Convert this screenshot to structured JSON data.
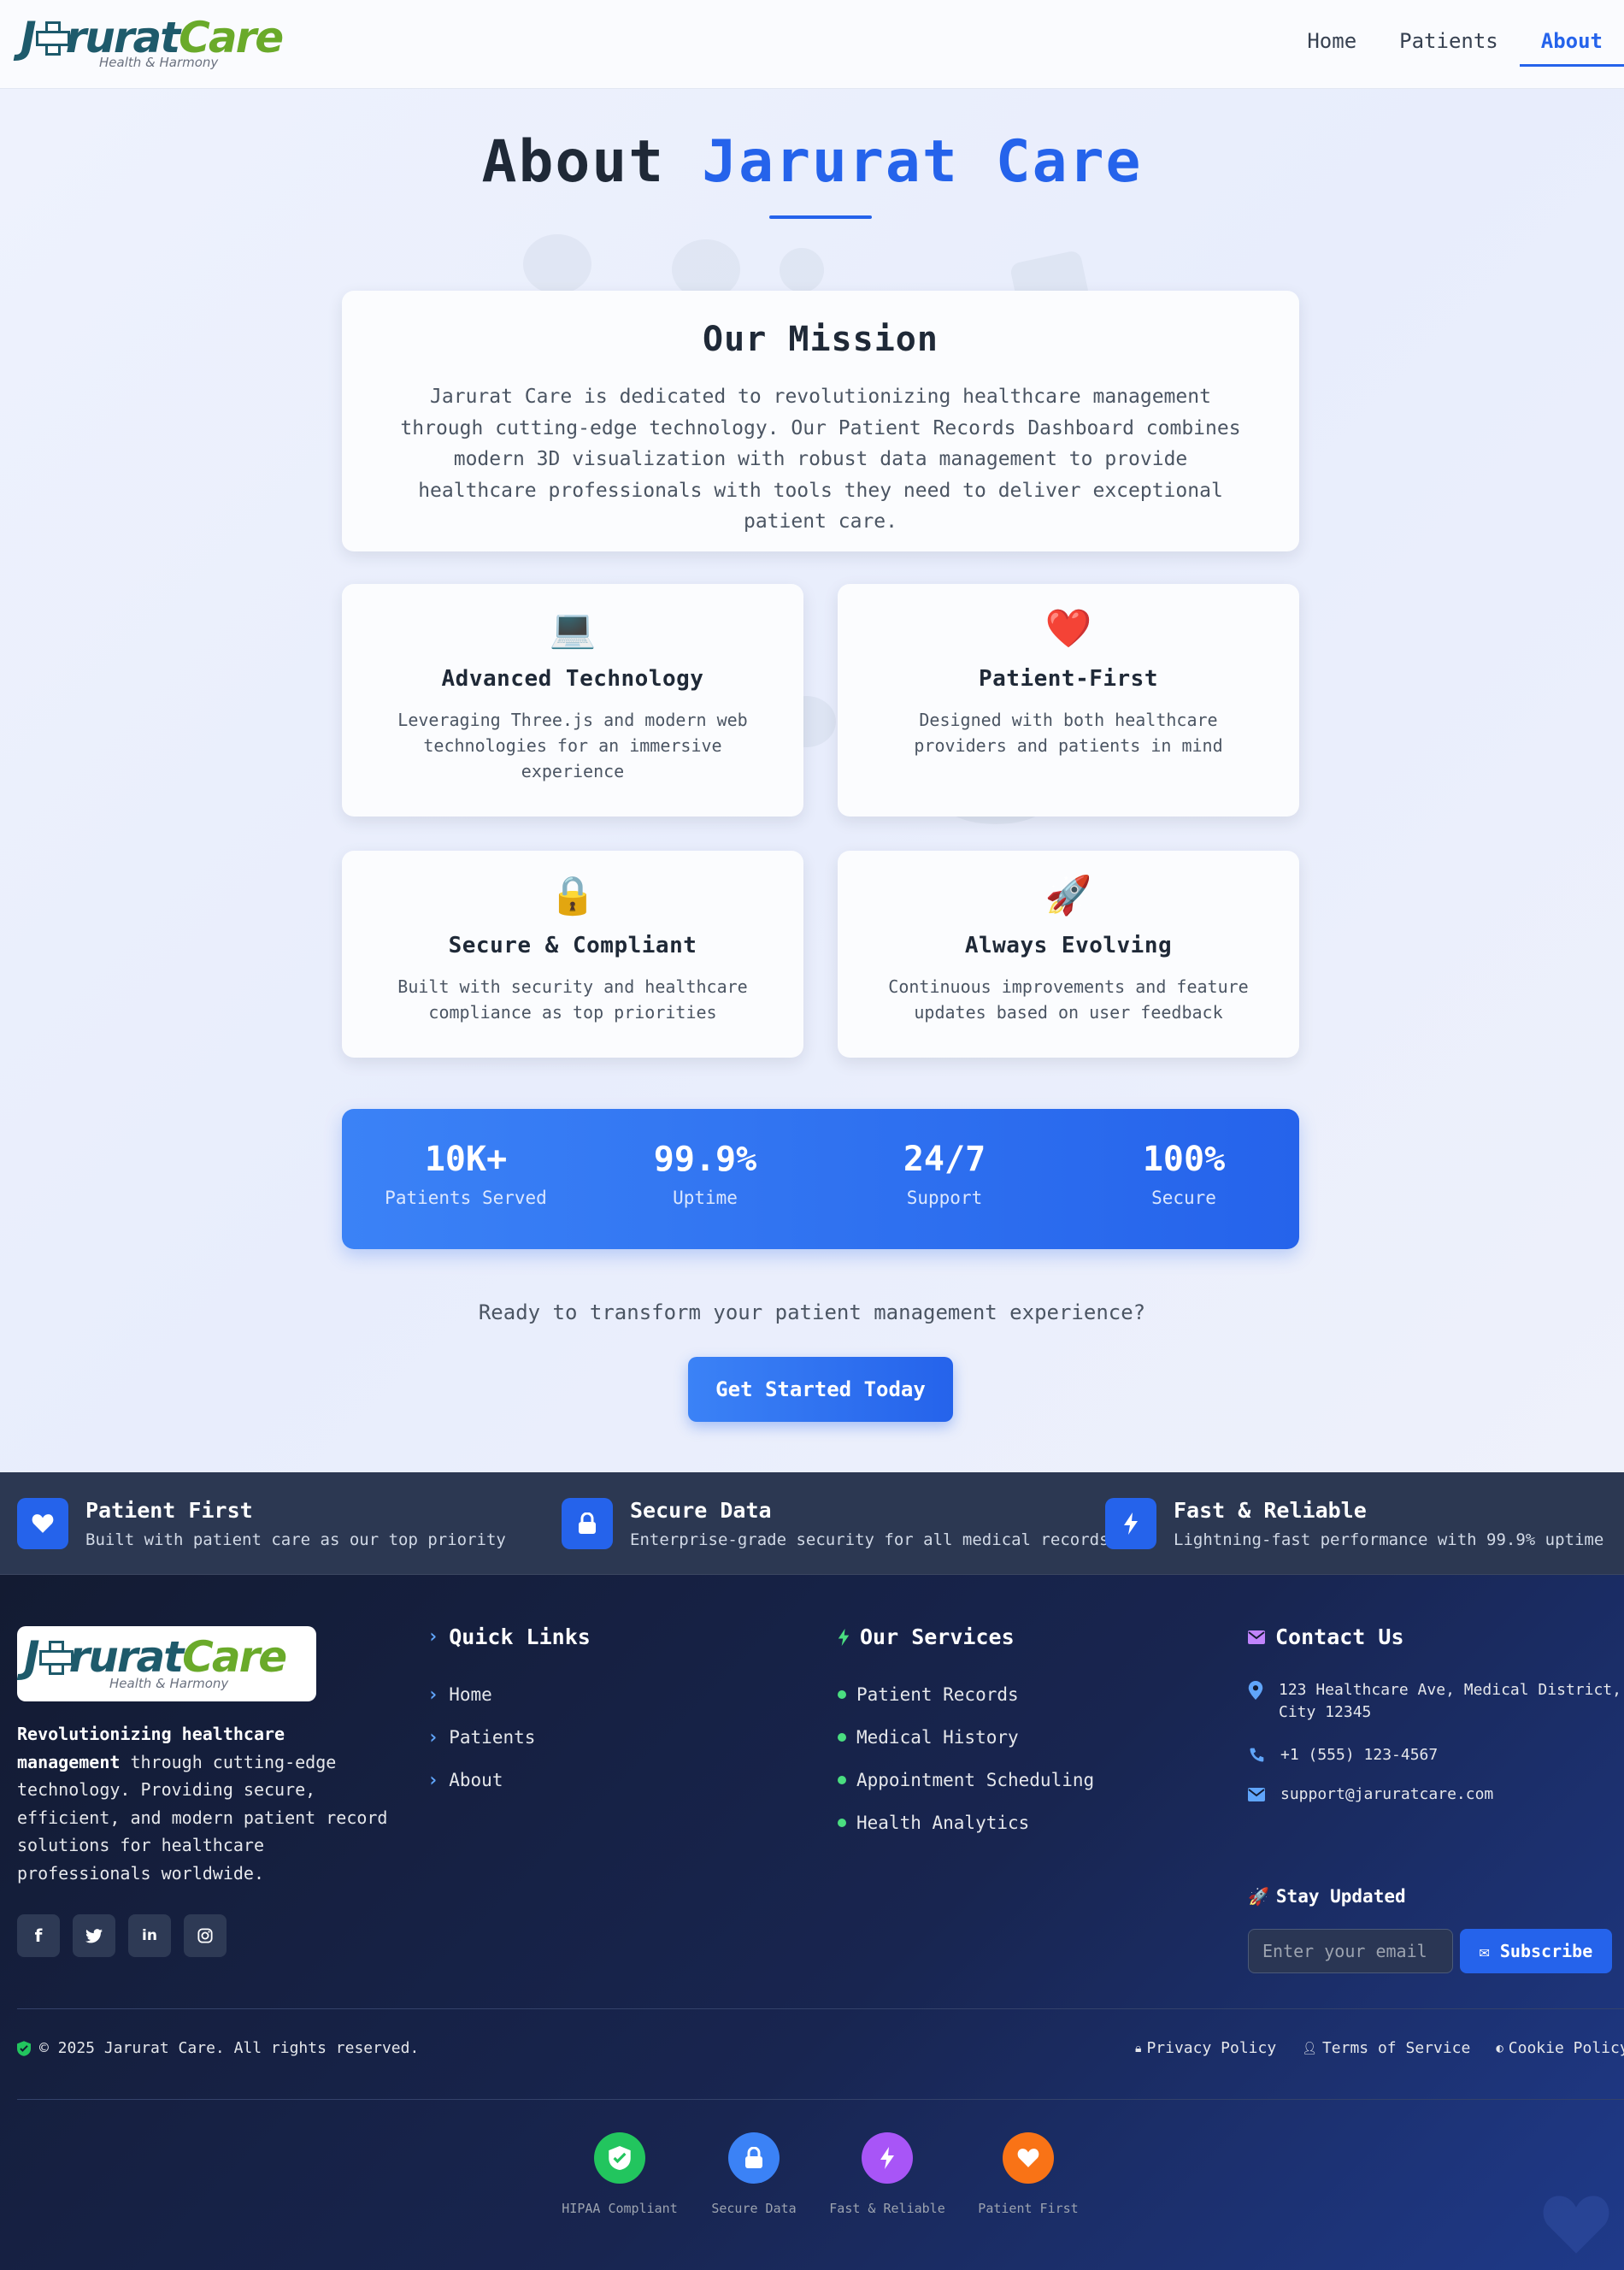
{
  "header": {
    "logo_text": "JururatCare",
    "logo_tagline": "Health & Harmony",
    "nav": [
      {
        "label": "Home"
      },
      {
        "label": "Patients"
      },
      {
        "label": "About"
      }
    ]
  },
  "about": {
    "title_main": "About",
    "title_accent": "Jarurat Care",
    "mission": {
      "heading": "Our Mission",
      "text": "Jarurat Care is dedicated to revolutionizing healthcare management through cutting-edge technology. Our Patient Records Dashboard combines modern 3D visualization with robust data management to provide healthcare professionals with tools they need to deliver exceptional patient care."
    },
    "features": [
      {
        "icon": "💻",
        "icon_name": "laptop-icon",
        "title": "Advanced Technology",
        "text": "Leveraging Three.js and modern web technologies for an immersive experience"
      },
      {
        "icon": "❤️",
        "icon_name": "heart-icon",
        "title": "Patient-First",
        "text": "Designed with both healthcare providers and patients in mind"
      },
      {
        "icon": "🔒",
        "icon_name": "lock-icon",
        "title": "Secure & Compliant",
        "text": "Built with security and healthcare compliance as top priorities"
      },
      {
        "icon": "🚀",
        "icon_name": "rocket-icon",
        "title": "Always Evolving",
        "text": "Continuous improvements and feature updates based on user feedback"
      }
    ],
    "stats": [
      {
        "value": "10K+",
        "label": "Patients Served"
      },
      {
        "value": "99.9%",
        "label": "Uptime"
      },
      {
        "value": "24/7",
        "label": "Support"
      },
      {
        "value": "100%",
        "label": "Secure"
      }
    ],
    "cta_text": "Ready to transform your patient management experience?",
    "cta_button": "Get Started Today"
  },
  "feature_strip": [
    {
      "icon": "heart-icon",
      "title": "Patient First",
      "desc": "Built with patient care as our top priority"
    },
    {
      "icon": "lock-icon",
      "title": "Secure Data",
      "desc": "Enterprise-grade security for all medical records"
    },
    {
      "icon": "bolt-icon",
      "title": "Fast & Reliable",
      "desc": "Lightning-fast performance with 99.9% uptime"
    }
  ],
  "footer": {
    "about_bold": "Revolutionizing healthcare management",
    "about_rest": " through cutting-edge technology. Providing secure, efficient, and modern patient record solutions for healthcare professionals worldwide.",
    "socials": [
      "facebook-icon",
      "twitter-icon",
      "linkedin-icon",
      "instagram-icon"
    ],
    "quick_links": {
      "title": "Quick Links",
      "items": [
        "Home",
        "Patients",
        "About"
      ]
    },
    "services": {
      "title": "Our Services",
      "items": [
        "Patient Records",
        "Medical History",
        "Appointment Scheduling",
        "Health Analytics"
      ]
    },
    "contact": {
      "title": "Contact Us",
      "address": "123 Healthcare Ave, Medical District, City 12345",
      "phone": "+1 (555) 123-4567",
      "email": "support@jaruratcare.com"
    },
    "newsletter": {
      "title": "Stay Updated",
      "placeholder": "Enter your email",
      "button": "Subscribe"
    },
    "copyright": "© 2025 Jarurat Care. All rights reserved.",
    "legal": [
      "Privacy Policy",
      "Terms of Service",
      "Cookie Policy"
    ],
    "badges": [
      {
        "label": "HIPAA Compliant",
        "color": "#22c55e",
        "icon": "shield-check-icon"
      },
      {
        "label": "Secure Data",
        "color": "#3b82f6",
        "icon": "lock-icon"
      },
      {
        "label": "Fast & Reliable",
        "color": "#a855f7",
        "icon": "bolt-icon"
      },
      {
        "label": "Patient First",
        "color": "#f97316",
        "icon": "heart-icon"
      }
    ]
  },
  "colors": {
    "accent": "#2563eb",
    "brand_teal": "#1e5a6b",
    "brand_green": "#6aaa2a",
    "footer_bg": "#131b32"
  }
}
